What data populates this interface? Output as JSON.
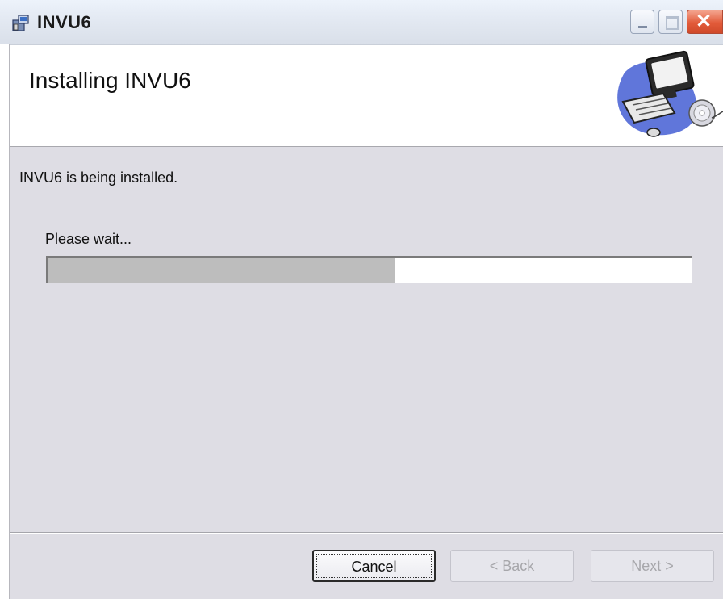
{
  "window": {
    "title": "INVU6",
    "controls": {
      "minimize": "minimize",
      "maximize": "maximize",
      "close": "✕"
    }
  },
  "banner": {
    "title": "Installing INVU6"
  },
  "content": {
    "status_message": "INVU6 is being installed.",
    "wait_label": "Please wait...",
    "progress_fraction": 0.54
  },
  "buttons": {
    "cancel": "Cancel",
    "back": "< Back",
    "next": "Next >"
  },
  "colors": {
    "progress_fill": "#bdbdbd",
    "close_button": "#e25b3a"
  },
  "icons": {
    "app": "installer-package-icon",
    "banner": "computer-with-cd-icon"
  }
}
